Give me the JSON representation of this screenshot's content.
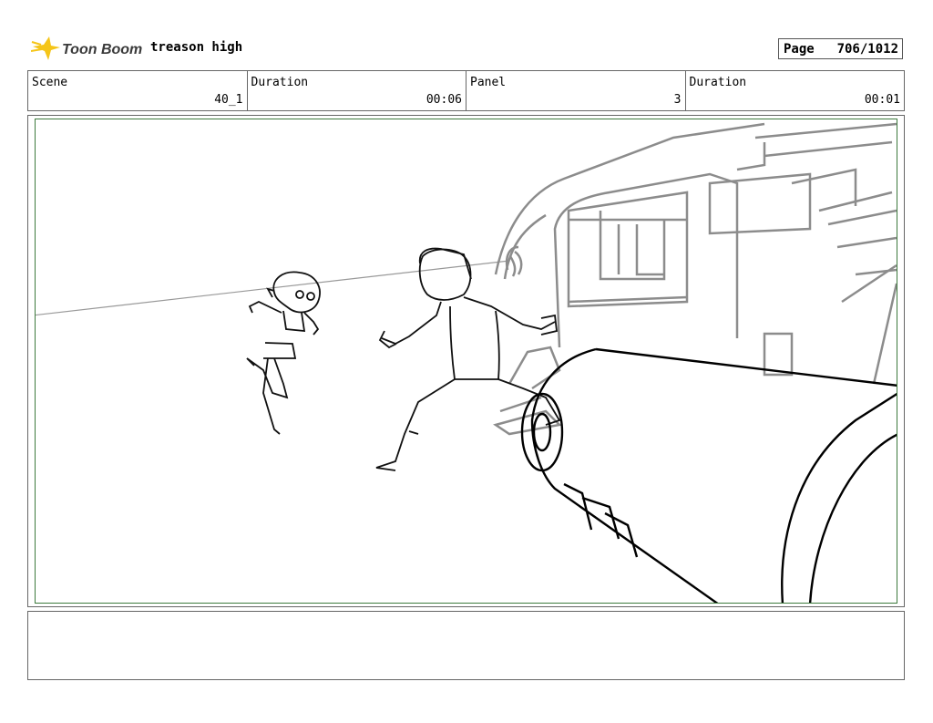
{
  "header": {
    "logo_text": "Toon Boom",
    "project_title": "treason high",
    "page_label": "Page",
    "page_value": "706/1012"
  },
  "fields": [
    {
      "label": "Scene",
      "value": "40_1"
    },
    {
      "label": "Duration",
      "value": "00:06"
    },
    {
      "label": "Panel",
      "value": "3"
    },
    {
      "label": "Duration",
      "value": "00:01"
    }
  ],
  "notes": {
    "text": ""
  },
  "colors": {
    "frame_border": "#666666",
    "panel_border": "#3d7a3d",
    "logo_star": "#f5c518",
    "logo_text": "#3a3a3a"
  }
}
